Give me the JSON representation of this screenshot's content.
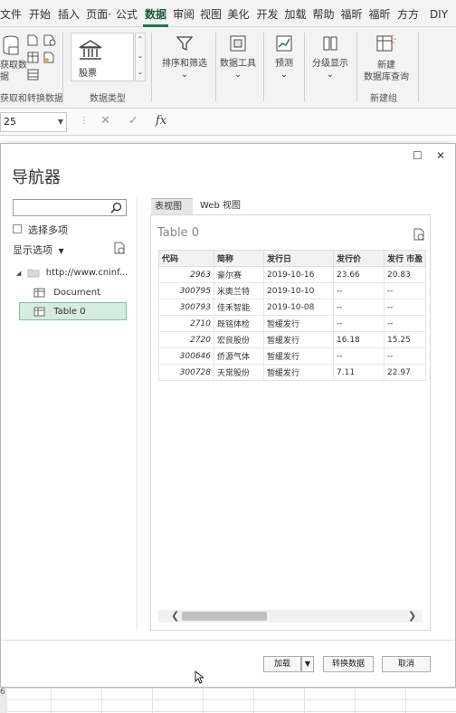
{
  "ribbon_tabs": [
    {
      "label": "文件"
    },
    {
      "label": "开始"
    },
    {
      "label": "插入"
    },
    {
      "label": "页面·"
    },
    {
      "label": "公式"
    },
    {
      "label": "数据"
    },
    {
      "label": "审阅"
    },
    {
      "label": "视图"
    },
    {
      "label": "美化"
    },
    {
      "label": "开发"
    },
    {
      "label": "加载"
    },
    {
      "label": "帮助"
    },
    {
      "label": "福昕"
    },
    {
      "label": "福昕"
    },
    {
      "label": "方方"
    },
    {
      "label": "DIY"
    }
  ],
  "ribbon": {
    "get_data_label": "获取数\n据",
    "group_get_transform": "获取和转换数据",
    "data_type_value": "股票",
    "group_data_types": "数据类型",
    "sort_filter": "排序和筛选",
    "data_tools": "数据工具",
    "forecast": "预测",
    "outline": "分级显示",
    "new_db_query": "新建\n数据库查询",
    "group_new": "新建组"
  },
  "formula_bar": {
    "name_box": "25",
    "cancel_glyph": "✕",
    "enter_glyph": "✓",
    "fx_label": "fx"
  },
  "navigator": {
    "title": "导航器",
    "search_placeholder": "",
    "select_multiple": "选择多项",
    "display_options": "显示选项",
    "tree": {
      "root": "http://www.cninf...",
      "document": "Document",
      "table0": "Table 0"
    },
    "preview_tabs": [
      "表视图",
      "Web 视图"
    ],
    "preview_title": "Table 0",
    "columns": [
      "代码",
      "简称",
      "发行日",
      "发行价",
      "发行 市盈"
    ],
    "rows": [
      [
        "2963",
        "豪尔赛",
        "2019-10-16",
        "23.66",
        "20.83"
      ],
      [
        "300795",
        "米奥兰特",
        "2019-10-10",
        "--",
        "--"
      ],
      [
        "300793",
        "佳禾智能",
        "2019-10-08",
        "--",
        "--"
      ],
      [
        "2710",
        "既铭体检",
        "暂缓发行",
        "--",
        "--"
      ],
      [
        "2720",
        "宏良股份",
        "暂缓发行",
        "16.18",
        "15.25"
      ],
      [
        "300646",
        "侨源气体",
        "暂缓发行",
        "--",
        "--"
      ],
      [
        "300728",
        "天常股份",
        "暂缓发行",
        "7.11",
        "22.97"
      ]
    ],
    "buttons": {
      "load": "加载",
      "transform": "转换数据",
      "cancel": "取消"
    }
  },
  "sheet": {
    "row_label": "6"
  },
  "colors": {
    "excel_green": "#217346",
    "selection": "#d5ece1"
  }
}
